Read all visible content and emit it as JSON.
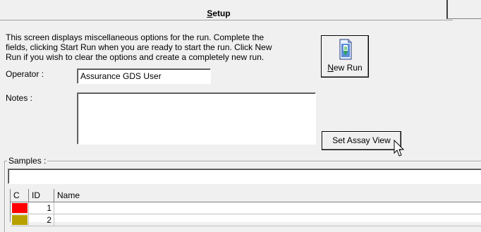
{
  "header": {
    "title_prefix": "S",
    "title_rest": "etup"
  },
  "description": "This screen displays miscellaneous options for the run. Complete the fields, clicking Start Run when you are ready to start the run. Click New Run if you wish to clear the options and create a completely new run.",
  "new_run": {
    "label_prefix": "N",
    "label_rest": "ew Run",
    "icon": "new-run-document-icon"
  },
  "operator": {
    "label": "Operator :",
    "value": "Assurance GDS User"
  },
  "notes": {
    "label": "Notes :",
    "value": ""
  },
  "set_assay_view": {
    "label": "Set Assay View"
  },
  "samples": {
    "label": "Samples :",
    "input_value": "",
    "columns": [
      "C",
      "ID",
      "Name"
    ],
    "rows": [
      {
        "id": "1",
        "name": "",
        "color": "#ff0000"
      },
      {
        "id": "2",
        "name": "",
        "color": "#b8a000"
      }
    ]
  }
}
